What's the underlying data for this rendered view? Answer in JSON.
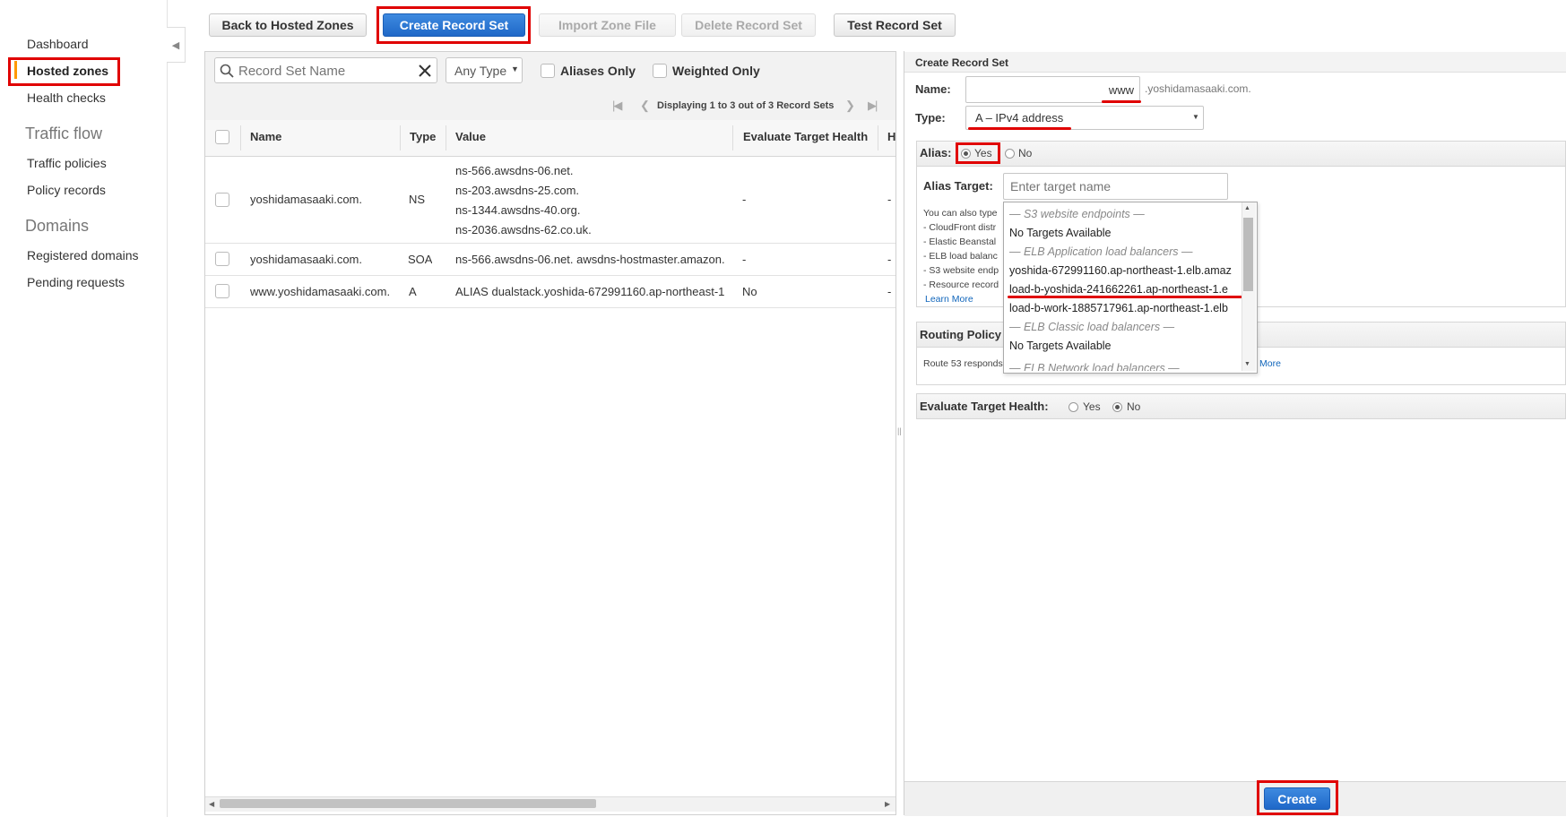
{
  "nav": {
    "items": [
      "Dashboard",
      "Hosted zones",
      "Health checks"
    ],
    "traffic_flow": {
      "title": "Traffic flow",
      "items": [
        "Traffic policies",
        "Policy records"
      ]
    },
    "domains": {
      "title": "Domains",
      "items": [
        "Registered domains",
        "Pending requests"
      ]
    },
    "accent": "#ff9900"
  },
  "toolbar": {
    "back": "Back to Hosted Zones",
    "create": "Create Record Set",
    "import": "Import Zone File",
    "delete": "Delete Record Set",
    "test": "Test Record Set"
  },
  "filters": {
    "search_placeholder": "Record Set Name",
    "type_select": "Any Type",
    "aliases_only": "Aliases Only",
    "weighted_only": "Weighted Only",
    "pagination": "Displaying 1 to 3 out of 3 Record Sets"
  },
  "table": {
    "columns": [
      "Name",
      "Type",
      "Value",
      "Evaluate Target Health",
      "H"
    ],
    "rows": [
      {
        "name": "yoshidamasaaki.com.",
        "type": "NS",
        "values": [
          "ns-566.awsdns-06.net.",
          "ns-203.awsdns-25.com.",
          "ns-1344.awsdns-40.org.",
          "ns-2036.awsdns-62.co.uk."
        ],
        "eval": "-",
        "h": "-"
      },
      {
        "name": "yoshidamasaaki.com.",
        "type": "SOA",
        "values": [
          "ns-566.awsdns-06.net. awsdns-hostmaster.amazon."
        ],
        "eval": "-",
        "h": "-"
      },
      {
        "name": "www.yoshidamasaaki.com.",
        "type": "A",
        "values": [
          "ALIAS dualstack.yoshida-672991160.ap-northeast-1"
        ],
        "eval": "No",
        "h": "-"
      }
    ]
  },
  "form": {
    "title": "Create Record Set",
    "name_label": "Name:",
    "name_value": "www",
    "name_suffix": ".yoshidamasaaki.com.",
    "type_label": "Type:",
    "type_value": "A – IPv4 address",
    "alias_label": "Alias:",
    "alias_yes": "Yes",
    "alias_no": "No",
    "alias_target_label": "Alias Target:",
    "alias_target_placeholder": "Enter target name",
    "help_lines": [
      "You can also type",
      "- CloudFront distr",
      "- Elastic Beanstal",
      "- ELB load balanc",
      "- S3 website endp",
      "- Resource record"
    ],
    "learn_more": "Learn More",
    "routing_label": "Routing Policy",
    "routing_text": "Route 53 responds",
    "routing_more": "More",
    "eval_label": "Evaluate Target Health:",
    "eval_yes": "Yes",
    "eval_no": "No",
    "create_button": "Create"
  },
  "dropdown": [
    {
      "text": "— S3 website endpoints —",
      "group": true
    },
    {
      "text": "No Targets Available",
      "group": false
    },
    {
      "text": "— ELB Application load balancers —",
      "group": true
    },
    {
      "text": "yoshida-672991160.ap-northeast-1.elb.amaz",
      "group": false
    },
    {
      "text": "load-b-yoshida-241662261.ap-northeast-1.e",
      "group": false
    },
    {
      "text": "load-b-work-1885717961.ap-northeast-1.elb",
      "group": false
    },
    {
      "text": "— ELB Classic load balancers —",
      "group": true
    },
    {
      "text": "No Targets Available",
      "group": false
    },
    {
      "text": "— ELB Network load balancers —",
      "group": true
    }
  ]
}
